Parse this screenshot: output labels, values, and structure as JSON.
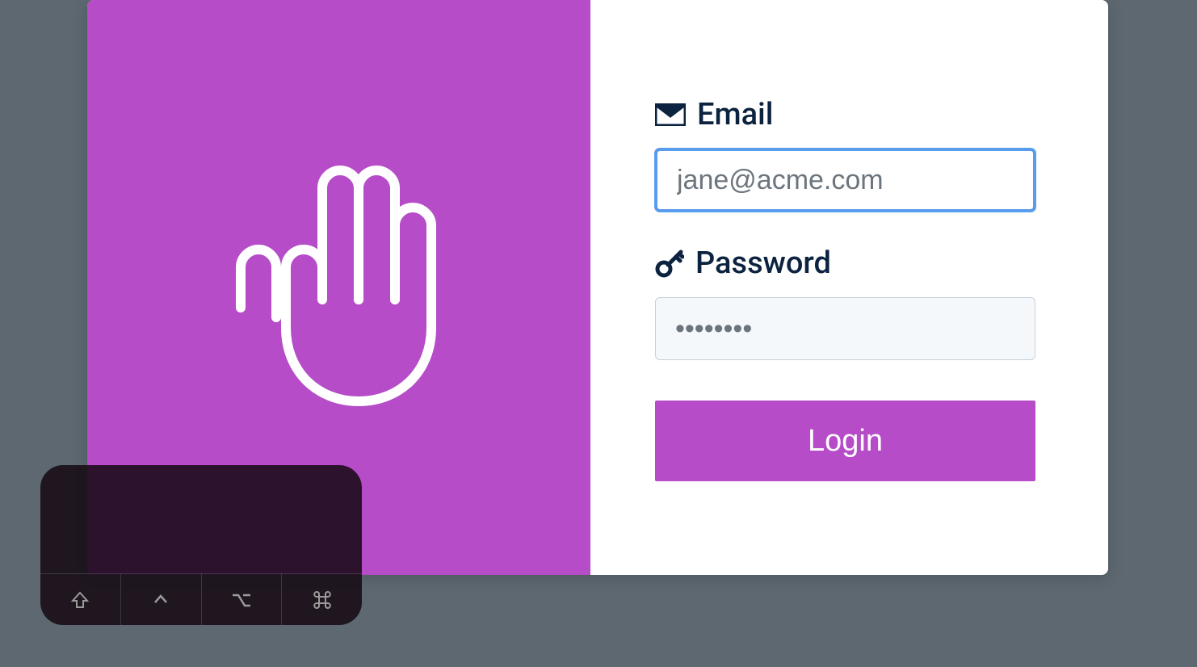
{
  "colors": {
    "accent": "#b64cc8",
    "focus": "#5a9cec",
    "text_dark": "#0c2340",
    "bg_page": "#5d6870"
  },
  "form": {
    "email": {
      "label": "Email",
      "placeholder": "jane@acme.com",
      "value": ""
    },
    "password": {
      "label": "Password",
      "placeholder": "••••••••",
      "value": ""
    },
    "submit_label": "Login"
  },
  "keyboard": {
    "keys": [
      "shift",
      "control",
      "option",
      "command"
    ]
  }
}
